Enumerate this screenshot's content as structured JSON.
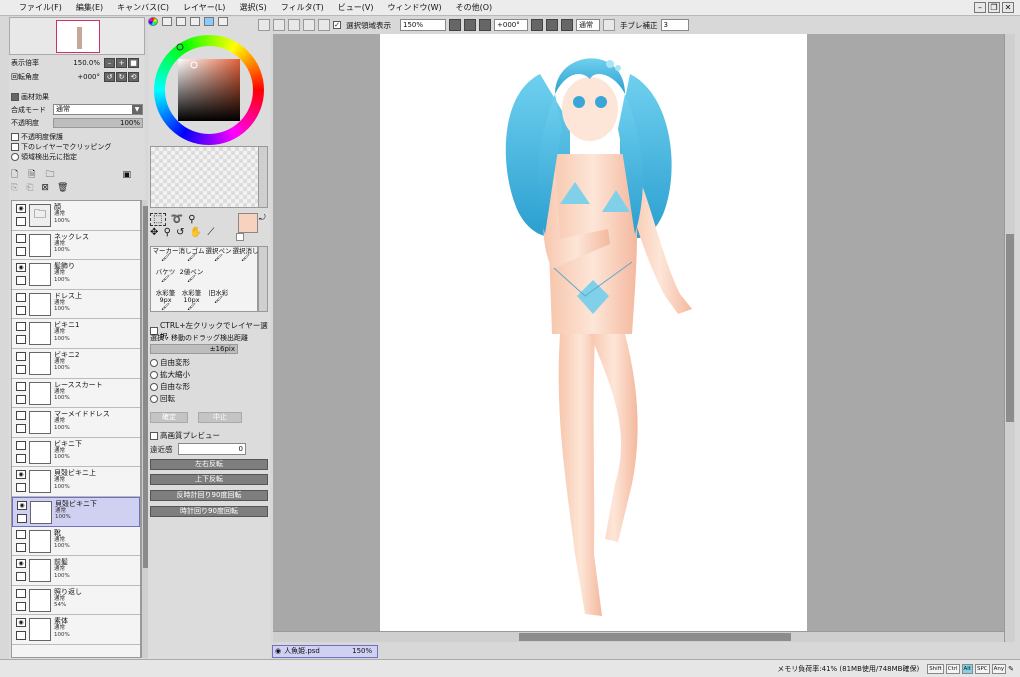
{
  "menu": [
    "ファイル(F)",
    "編集(E)",
    "キャンバス(C)",
    "レイヤー(L)",
    "選択(S)",
    "フィルタ(T)",
    "ビュー(V)",
    "ウィンドウ(W)",
    "その他(O)"
  ],
  "nav": {
    "zoom_label": "表示倍率",
    "zoom_value": "150.0%",
    "rotate_label": "回転角度",
    "rotate_value": "+000°"
  },
  "layer_props": {
    "effects_label": "画材効果",
    "blend_label": "合成モード",
    "blend_value": "通常",
    "opacity_label": "不透明度",
    "opacity_value": "100%",
    "checks": [
      "不透明度保護",
      "下のレイヤーでクリッピング",
      "領域検出元に指定"
    ]
  },
  "layers": [
    {
      "name": "顔",
      "mode": "通常",
      "opacity": "100%",
      "visible": true,
      "folder": true
    },
    {
      "name": "ネックレス",
      "mode": "通常",
      "opacity": "100%",
      "visible": false
    },
    {
      "name": "髪飾り",
      "mode": "通常",
      "opacity": "100%",
      "visible": true
    },
    {
      "name": "ドレス上",
      "mode": "通常",
      "opacity": "100%",
      "visible": false
    },
    {
      "name": "ビキニ1",
      "mode": "通常",
      "opacity": "100%",
      "visible": false
    },
    {
      "name": "ビキニ2",
      "mode": "通常",
      "opacity": "100%",
      "visible": false
    },
    {
      "name": "レーススカート",
      "mode": "通常",
      "opacity": "100%",
      "visible": false
    },
    {
      "name": "マーメイドドレス",
      "mode": "通常",
      "opacity": "100%",
      "visible": false
    },
    {
      "name": "ビキニ下",
      "mode": "通常",
      "opacity": "100%",
      "visible": false
    },
    {
      "name": "貝殻ビキニ上",
      "mode": "通常",
      "opacity": "100%",
      "visible": true
    },
    {
      "name": "貝殻ビキニ下",
      "mode": "通常",
      "opacity": "100%",
      "visible": true,
      "selected": true
    },
    {
      "name": "靴",
      "mode": "通常",
      "opacity": "100%",
      "visible": false
    },
    {
      "name": "前髪",
      "mode": "通常",
      "opacity": "100%",
      "visible": true
    },
    {
      "name": "照り返し",
      "mode": "通常",
      "opacity": "54%",
      "visible": false
    },
    {
      "name": "素体",
      "mode": "通常",
      "opacity": "100%",
      "visible": true
    }
  ],
  "brushes": [
    {
      "name": "マーカー"
    },
    {
      "name": "消しゴム"
    },
    {
      "name": "選択ペン"
    },
    {
      "name": "選択消し"
    },
    {
      "name": "バケツ"
    },
    {
      "name": "2値ペン"
    },
    {
      "name": "水彩筆",
      "size": "9px"
    },
    {
      "name": "水彩筆",
      "size": "10px"
    },
    {
      "name": "旧水彩"
    }
  ],
  "tool_opts": {
    "ctrl_click": "CTRL+左クリックでレイヤー選択",
    "drag_label": "選択・移動のドラッグ検出距離",
    "drag_value": "±16pix",
    "transforms": [
      "自由変形",
      "拡大縮小",
      "自由な形",
      "回転"
    ],
    "ok": "確定",
    "cancel": "中止",
    "hq_preview": "高画質プレビュー",
    "perspective_label": "遠近感",
    "perspective_value": "0",
    "actions": [
      "左右反転",
      "上下反転",
      "反時計回り90度回転",
      "時計回り90度回転"
    ]
  },
  "toolbar": {
    "show_selection": "選択領域表示",
    "zoom": "150%",
    "angle": "+000°",
    "blend": "通常",
    "stabilizer_label": "手ブレ補正",
    "stabilizer_value": "3"
  },
  "doc_tab": {
    "name": "人魚姫.psd",
    "zoom": "150%"
  },
  "status": {
    "memory": "メモリ負荷率:41% (81MB使用/748MB確保)",
    "keys": [
      "Shift",
      "Ctrl",
      "Alt",
      "SPC",
      "Any"
    ]
  },
  "colors": {
    "accent": "#7070c0",
    "fg_swatch": "#f7d2bf",
    "bg_swatch": "#ffffff"
  }
}
